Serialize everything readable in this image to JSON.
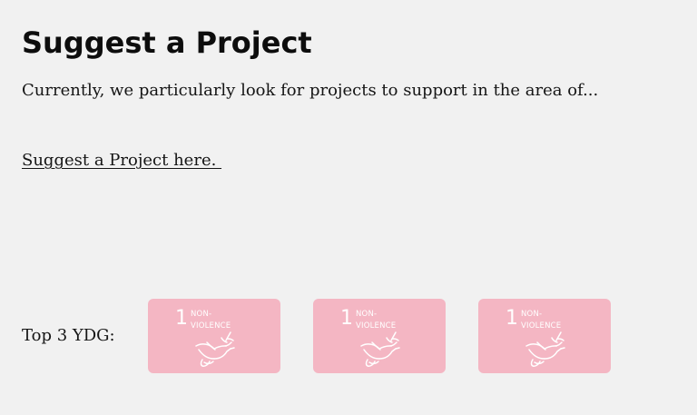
{
  "page": {
    "title": "Suggest a Project",
    "intro": "Currently, we particularly look for projects to support in the area of...",
    "suggest_link": "Suggest a Project here. "
  },
  "ydg": {
    "label": "Top 3 YDG:",
    "card_color": "#f4b6c3",
    "cards": [
      {
        "number": "1",
        "line1": "NON-",
        "line2": "VIOLENCE",
        "icon": "dove-icon"
      },
      {
        "number": "1",
        "line1": "NON-",
        "line2": "VIOLENCE",
        "icon": "dove-icon"
      },
      {
        "number": "1",
        "line1": "NON-",
        "line2": "VIOLENCE",
        "icon": "dove-icon"
      }
    ]
  }
}
